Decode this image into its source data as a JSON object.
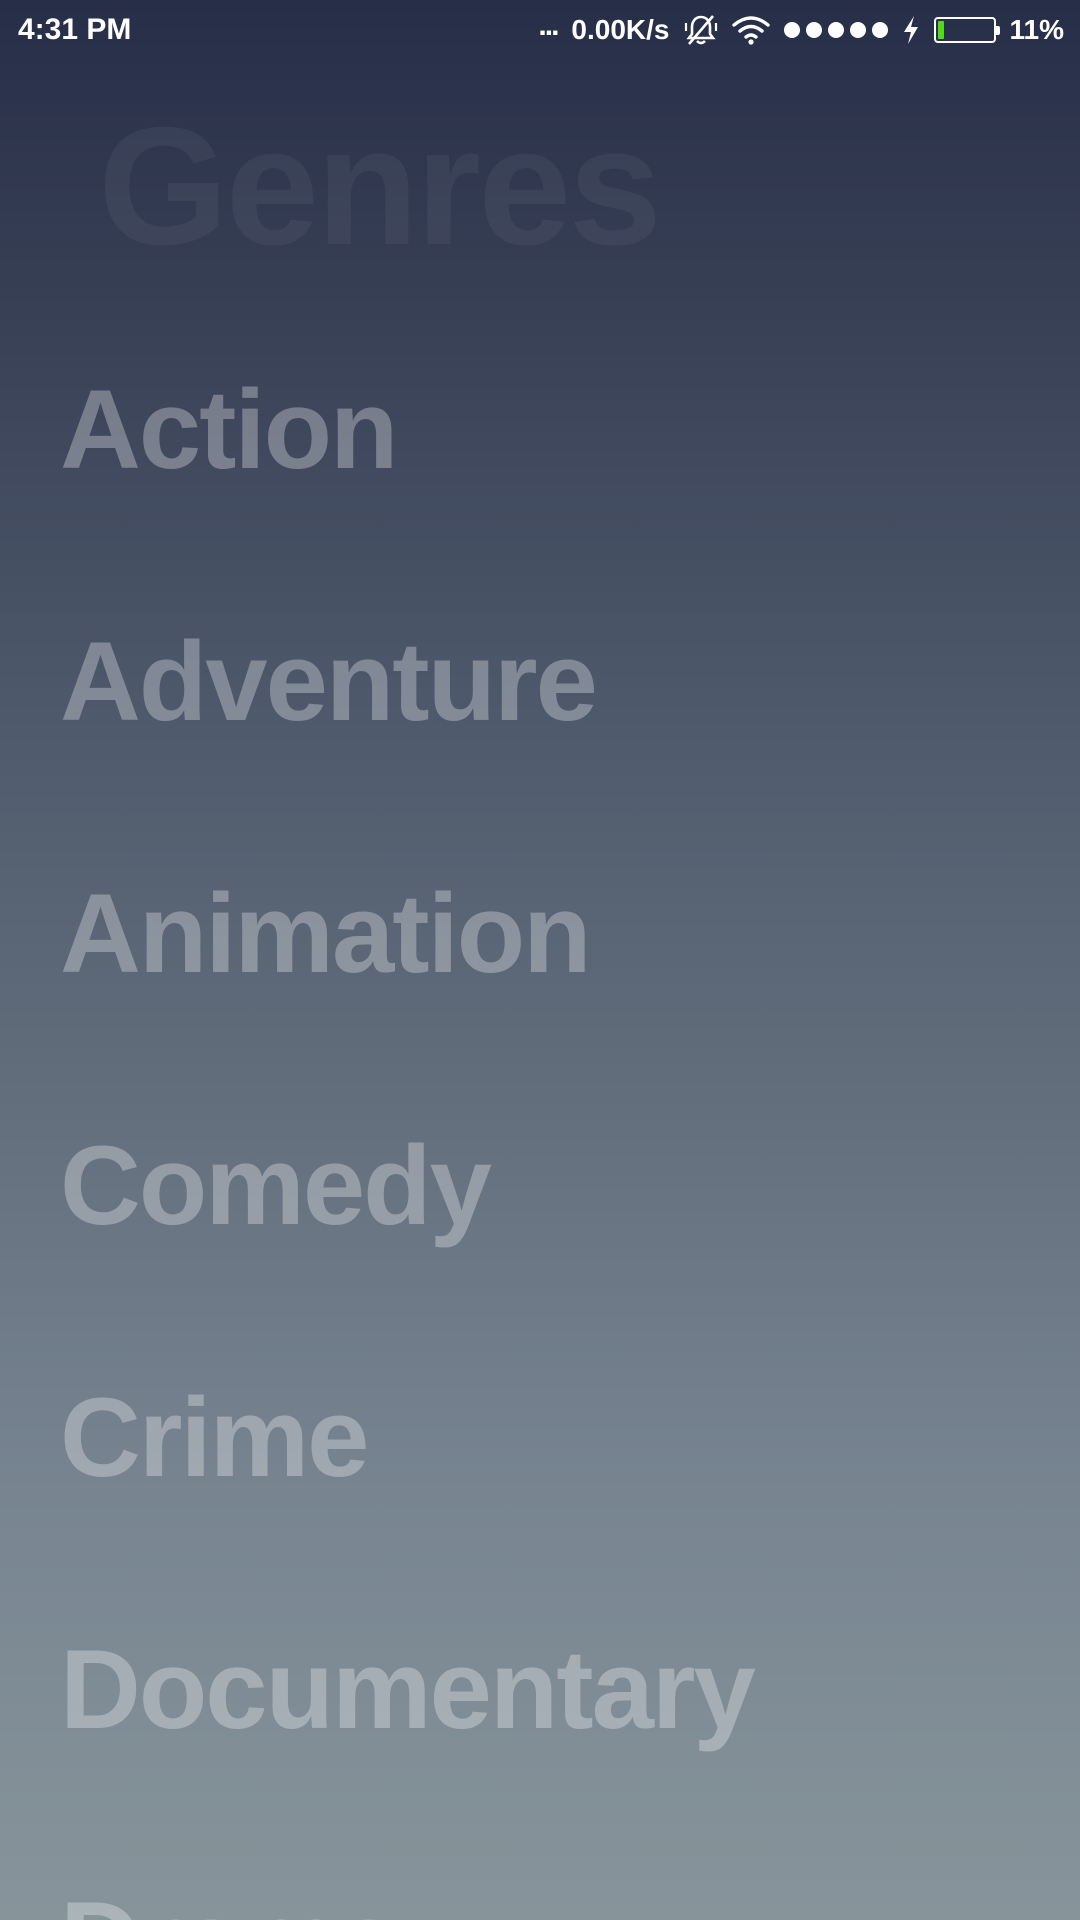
{
  "status_bar": {
    "time": "4:31 PM",
    "more_dots": "...",
    "net_speed": "0.00K/s",
    "battery_percent": "11%",
    "battery_level": 0.11,
    "battery_fill_color": "#54d81c",
    "icons": [
      "dots-icon",
      "mute-bell-icon",
      "wifi-icon",
      "signal-icon",
      "charging-icon",
      "battery-icon"
    ]
  },
  "page": {
    "title": "Genres"
  },
  "genres": [
    "Action",
    "Adventure",
    "Animation",
    "Comedy",
    "Crime",
    "Documentary",
    "Drama"
  ],
  "colors": {
    "gradient_top": "#272e48",
    "gradient_bottom": "#87949a",
    "text": "#ffffff"
  }
}
